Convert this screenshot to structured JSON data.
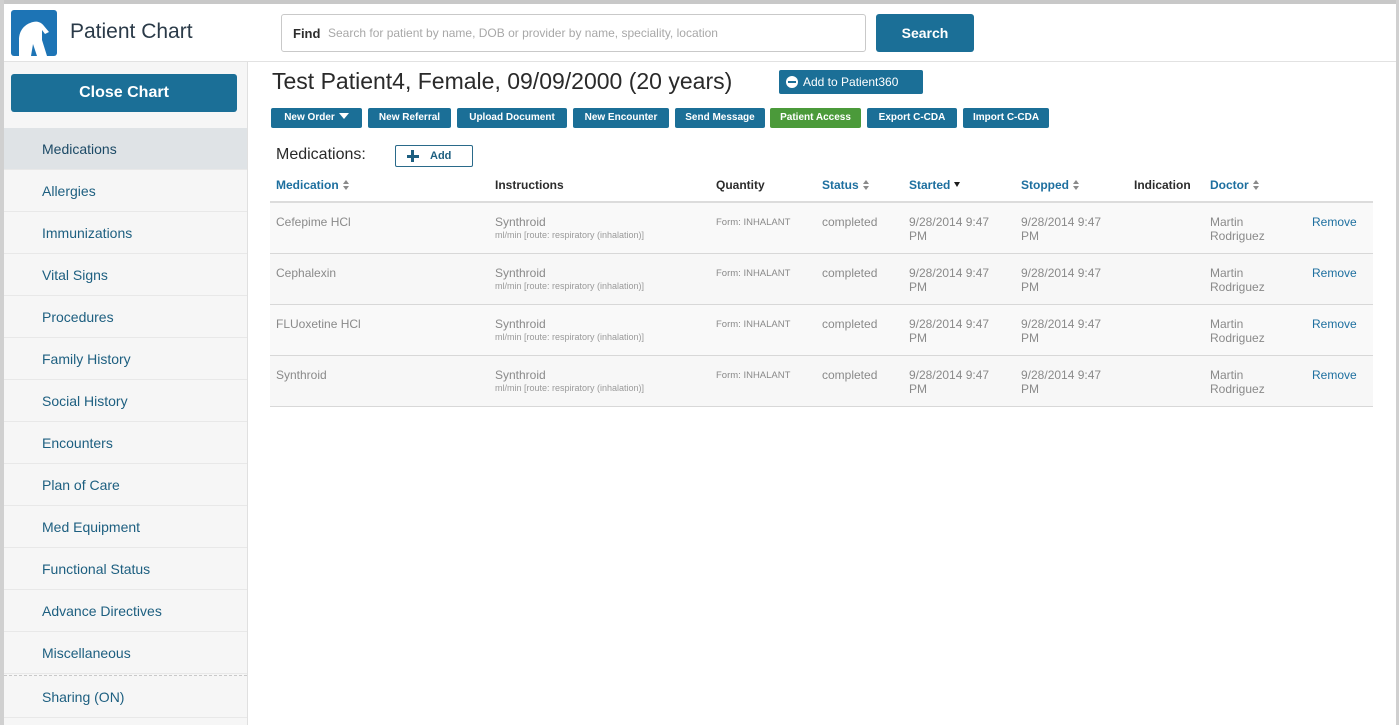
{
  "app": {
    "title": "Patient Chart",
    "find_label": "Find",
    "find_placeholder": "Search for patient by name, DOB or provider by name, speciality, location",
    "search_label": "Search"
  },
  "sidebar": {
    "close_chart_label": "Close Chart",
    "items": [
      {
        "label": "Medications",
        "active": true
      },
      {
        "label": "Allergies"
      },
      {
        "label": "Immunizations"
      },
      {
        "label": "Vital Signs"
      },
      {
        "label": "Procedures"
      },
      {
        "label": "Family History"
      },
      {
        "label": "Social History"
      },
      {
        "label": "Encounters"
      },
      {
        "label": "Plan of Care"
      },
      {
        "label": "Med Equipment"
      },
      {
        "label": "Functional Status"
      },
      {
        "label": "Advance Directives"
      },
      {
        "label": "Miscellaneous"
      },
      {
        "label": "Sharing (ON)"
      }
    ]
  },
  "patient": {
    "title": "Test Patient4, Female, 09/09/2000 (20 years)",
    "add_to_patient360_label": "Add to Patient360"
  },
  "actions": [
    {
      "label": "New Order"
    },
    {
      "label": "New Referral"
    },
    {
      "label": "Upload Document"
    },
    {
      "label": "New Encounter"
    },
    {
      "label": "Send Message"
    },
    {
      "label": "Patient Access"
    },
    {
      "label": "Export C-CDA"
    },
    {
      "label": "Import C-CDA"
    }
  ],
  "medications": {
    "section_label": "Medications:",
    "add_label": "Add",
    "columns": {
      "medication": "Medication",
      "instructions": "Instructions",
      "quantity": "Quantity",
      "status": "Status",
      "started": "Started",
      "stopped": "Stopped",
      "indication": "Indication",
      "doctor": "Doctor"
    },
    "rows": [
      {
        "medication": "Cefepime HCl",
        "instructions": "Synthroid",
        "instructions_detail": "ml/min [route: respiratory (inhalation)]",
        "quantity": "Form: INHALANT",
        "status": "completed",
        "started": "9/28/2014 9:47 PM",
        "stopped": "9/28/2014 9:47 PM",
        "doctor": "Martin Rodriguez",
        "remove": "Remove"
      },
      {
        "medication": "Cephalexin",
        "instructions": "Synthroid",
        "instructions_detail": "ml/min [route: respiratory (inhalation)]",
        "quantity": "Form: INHALANT",
        "status": "completed",
        "started": "9/28/2014 9:47 PM",
        "stopped": "9/28/2014 9:47 PM",
        "doctor": "Martin Rodriguez",
        "remove": "Remove"
      },
      {
        "medication": "FLUoxetine HCl",
        "instructions": "Synthroid",
        "instructions_detail": "ml/min [route: respiratory (inhalation)]",
        "quantity": "Form: INHALANT",
        "status": "completed",
        "started": "9/28/2014 9:47 PM",
        "stopped": "9/28/2014 9:47 PM",
        "doctor": "Martin Rodriguez",
        "remove": "Remove"
      },
      {
        "medication": "Synthroid",
        "instructions": "Synthroid",
        "instructions_detail": "ml/min [route: respiratory (inhalation)]",
        "quantity": "Form: INHALANT",
        "status": "completed",
        "started": "9/28/2014 9:47 PM",
        "stopped": "9/28/2014 9:47 PM",
        "doctor": "Martin Rodriguez",
        "remove": "Remove"
      }
    ]
  }
}
